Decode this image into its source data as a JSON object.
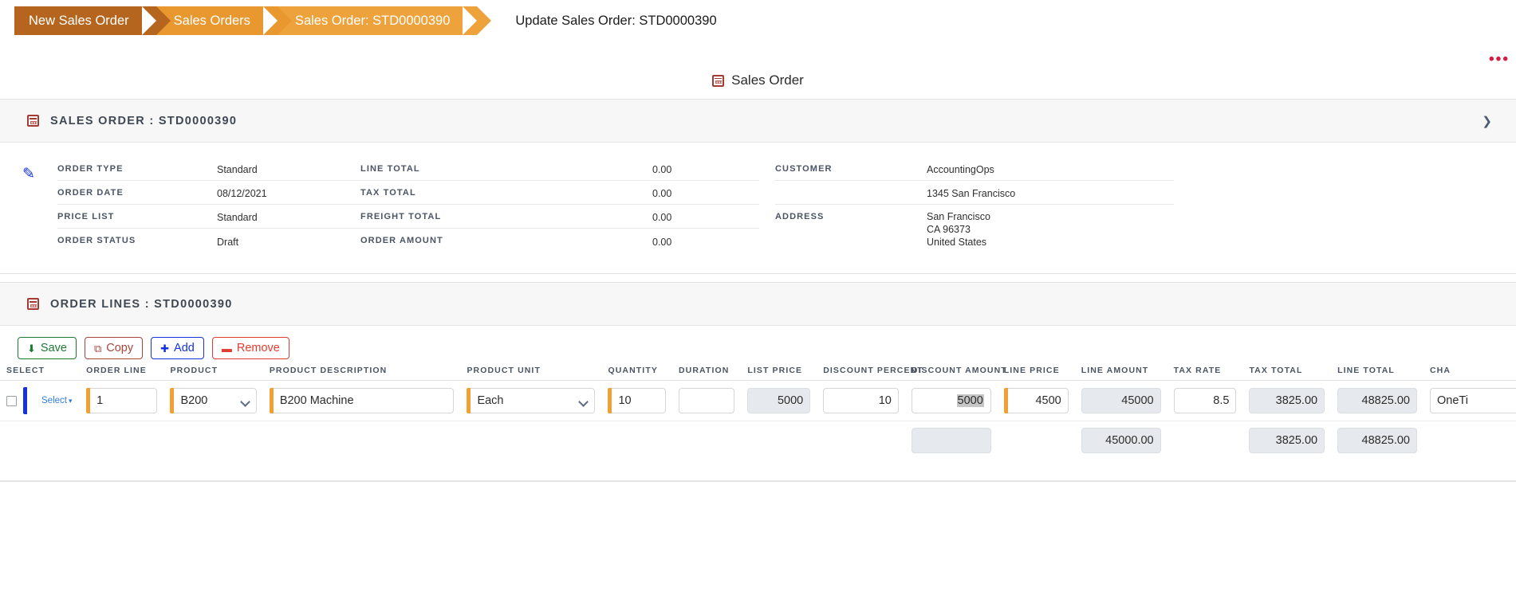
{
  "breadcrumb": {
    "items": [
      {
        "label": "New Sales Order"
      },
      {
        "label": "Sales Orders"
      },
      {
        "label": "Sales Order: STD0000390"
      }
    ],
    "page_title": "Update Sales Order: STD0000390"
  },
  "topbar": {
    "more_menu": "•••"
  },
  "page_tab": {
    "label": "Sales Order",
    "icon": "grid-icon"
  },
  "sales_order_section": {
    "title": "SALES ORDER : STD0000390",
    "collapse_icon": "chevron-down-icon",
    "edit_icon": "pencil-icon",
    "column1": [
      {
        "label": "ORDER TYPE",
        "value": "Standard"
      },
      {
        "label": "ORDER DATE",
        "value": "08/12/2021"
      },
      {
        "label": "PRICE LIST",
        "value": "Standard"
      },
      {
        "label": "ORDER STATUS",
        "value": "Draft"
      }
    ],
    "column2": [
      {
        "label": "LINE TOTAL",
        "value": "0.00"
      },
      {
        "label": "TAX TOTAL",
        "value": "0.00"
      },
      {
        "label": "FREIGHT TOTAL",
        "value": "0.00"
      },
      {
        "label": "ORDER AMOUNT",
        "value": "0.00"
      }
    ],
    "column3": [
      {
        "label": "CUSTOMER",
        "value": "AccountingOps"
      },
      {
        "label": "",
        "value": "1345 San Francisco"
      },
      {
        "label": "ADDRESS",
        "value": "San Francisco\nCA 96373\nUnited States"
      }
    ]
  },
  "order_lines_section": {
    "title": "ORDER LINES : STD0000390",
    "toolbar": [
      {
        "name": "save",
        "label": "Save",
        "icon": "save-icon"
      },
      {
        "name": "copy",
        "label": "Copy",
        "icon": "copy-icon"
      },
      {
        "name": "add",
        "label": "Add",
        "icon": "plus-icon"
      },
      {
        "name": "remove",
        "label": "Remove",
        "icon": "minus-icon"
      }
    ],
    "columns": [
      "SELECT",
      "ORDER LINE",
      "PRODUCT",
      "PRODUCT DESCRIPTION",
      "PRODUCT UNIT",
      "QUANTITY",
      "DURATION",
      "LIST PRICE",
      "DISCOUNT PERCENT",
      "DISCOUNT AMOUNT",
      "LINE PRICE",
      "LINE AMOUNT",
      "TAX RATE",
      "TAX TOTAL",
      "LINE TOTAL",
      "CHA"
    ],
    "row": {
      "select_checkbox": false,
      "select_link": "Select",
      "select_caret": "▾",
      "order_line": "1",
      "product": "B200",
      "product_description": "B200 Machine",
      "product_unit": "Each",
      "quantity": "10",
      "duration": "",
      "list_price": "5000",
      "discount_percent": "10",
      "discount_amount": "5000",
      "line_price": "4500",
      "line_amount": "45000",
      "tax_rate": "8.5",
      "tax_total": "3825.00",
      "line_total": "48825.00",
      "charge_type": "OneTi"
    },
    "totals": {
      "discount_amount": "",
      "line_amount": "45000.00",
      "tax_total": "3825.00",
      "line_total": "48825.00"
    }
  },
  "colors": {
    "crumb_active": "#b5651d",
    "crumb": "#e8982e",
    "accent_orange": "#f2a033",
    "accent_blue": "#1631e0",
    "save_green": "#1d7a33",
    "remove_red": "#e23b30",
    "readonly_bg": "#e6eaee"
  }
}
